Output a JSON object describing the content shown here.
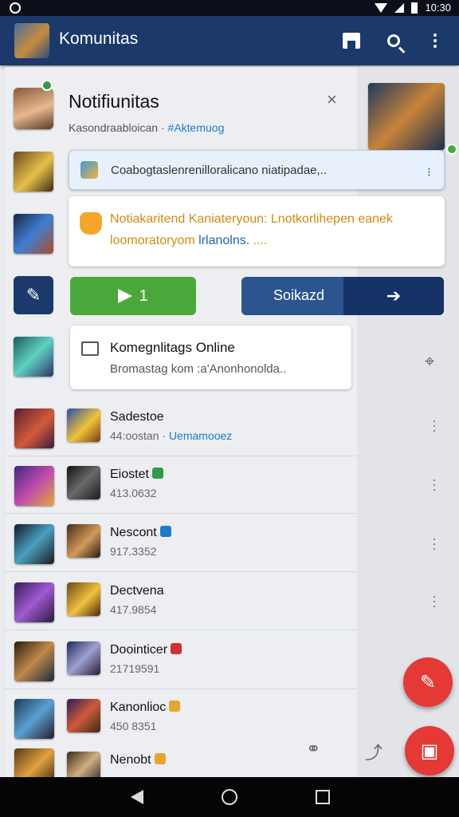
{
  "status_bar": {
    "time": "10:30"
  },
  "app_bar": {
    "title": "Komunitas"
  },
  "notification": {
    "title": "Notifiunitas",
    "subtitle_text": "Kasondraabloican · ",
    "subtitle_link": "#Aktemuog",
    "close_glyph": "×"
  },
  "search_card": {
    "text": "Coabogtaslenrenilloralicano niatipadae,.."
  },
  "alert_card": {
    "line1": "Notiakaritend Kaniateryoun: Lnotkorlihepen eanek",
    "line2_prefix": "loomoratoryom ",
    "line2_highlight": "lrlanolns.",
    "line2_suffix": " ...."
  },
  "actions": {
    "green_count": "1",
    "blue_label": "Soikazd"
  },
  "online_card": {
    "title": "Komegnlitags Online",
    "subtitle": "Bromastag kom :a'Anonhonolda.."
  },
  "list": [
    {
      "name": "Sadestoe",
      "sub": "44:oostan · ",
      "sub_link": "Uemamooez",
      "tag_color": ""
    },
    {
      "name": "Eiostet",
      "sub": "413.0632",
      "sub_link": "",
      "tag_color": "#2e9b46"
    },
    {
      "name": "Nescont",
      "sub": "917.3352",
      "sub_link": "",
      "tag_color": "#1e7bc9"
    },
    {
      "name": "Dectvena",
      "sub": "417.9854",
      "sub_link": "",
      "tag_color": ""
    },
    {
      "name": "Doointicer",
      "sub": "21719591",
      "sub_link": "",
      "tag_color": "#d32f2f"
    },
    {
      "name": "Kanonlioc",
      "sub": "450 8351",
      "sub_link": "",
      "tag_color": "#e3a72f"
    },
    {
      "name": "Nenobt",
      "sub": "",
      "sub_link": "",
      "tag_color": "#e3a72f"
    }
  ],
  "colors": {
    "app_bar": "#1b3a6b",
    "green_button": "#4aa83a",
    "blue_button": "#2c5590",
    "fab": "#e53935",
    "alert_text": "#d38a12"
  }
}
